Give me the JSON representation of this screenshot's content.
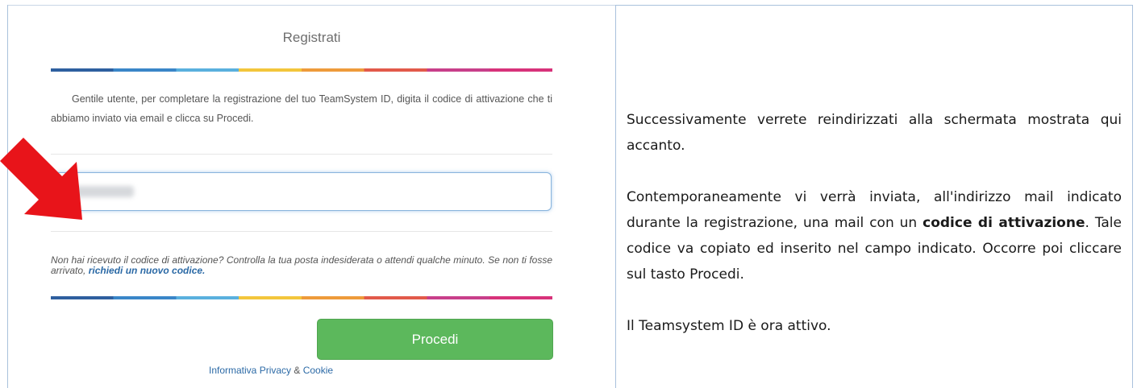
{
  "form": {
    "title": "Registrati",
    "instructions": "Gentile utente, per completare la registrazione del tuo TeamSystem ID, digita il codice di attivazione che ti abbiamo inviato via email e clicca su Procedi.",
    "code_input_value": "",
    "code_input_redacted": true,
    "help_text": "Non hai ricevuto il codice di attivazione? Controlla la tua posta indesiderata o attendi qualche minuto. Se non ti fosse arrivato, ",
    "help_link": "richiedi un nuovo codice.",
    "procedi_label": "Procedi",
    "privacy_link": "Informativa Privacy",
    "privacy_sep": " & ",
    "cookie_link": "Cookie"
  },
  "explanation": {
    "p1": "Successivamente verrete reindirizzati alla schermata mostrata qui accanto.",
    "p2_pre": "Contemporaneamente vi verrà inviata, all'indirizzo mail indicato durante la registrazione, una mail con un ",
    "p2_bold": "codice di attivazione",
    "p2_post": ". Tale codice va copiato ed inserito nel campo indicato. Occorre poi cliccare sul tasto Procedi.",
    "p3": "Il Teamsystem ID è ora attivo."
  },
  "colors": {
    "button_green": "#5cb85c",
    "arrow_red": "#e8141a",
    "link_blue": "#2c6aa6"
  },
  "icons": {
    "arrow": "red-arrow-icon"
  }
}
